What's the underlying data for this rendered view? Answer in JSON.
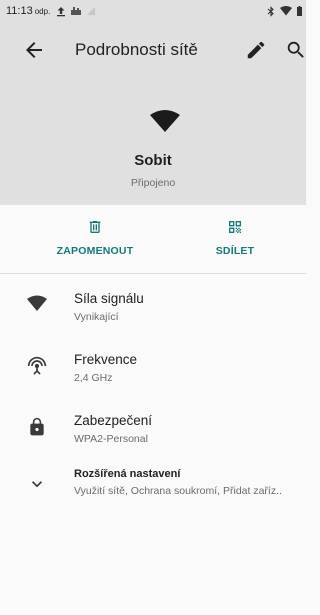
{
  "status_bar": {
    "time": "11:13",
    "ampm": "odp.",
    "icons_left": [
      "upload-icon",
      "notification-icon",
      "signal-icon"
    ],
    "icons_right": [
      "bluetooth-icon",
      "wifi-icon",
      "battery-icon"
    ]
  },
  "toolbar": {
    "title": "Podrobnosti sítě",
    "back_icon": "back-arrow-icon",
    "edit_icon": "edit-icon",
    "search_icon": "search-icon"
  },
  "network": {
    "name": "Sobit",
    "status": "Připojeno"
  },
  "actions": [
    {
      "label": "ZAPOMENOUT",
      "icon": "trash-icon"
    },
    {
      "label": "SDÍLET",
      "icon": "qr-code-icon"
    }
  ],
  "details": [
    {
      "title": "Síla signálu",
      "value": "Vynikající",
      "icon": "wifi-strength-icon"
    },
    {
      "title": "Frekvence",
      "value": "2,4 GHz",
      "icon": "antenna-icon"
    },
    {
      "title": "Zabezpečení",
      "value": "WPA2-Personal",
      "icon": "lock-icon"
    },
    {
      "title": "Rozšířená nastavení",
      "value": "Využití sítě, Ochrana soukromí, Přidat zaříz..",
      "icon": "chevron-down-icon"
    }
  ],
  "colors": {
    "accent": "#127a78",
    "header_bg": "#e0e0e0",
    "body_bg": "#fafafa"
  }
}
